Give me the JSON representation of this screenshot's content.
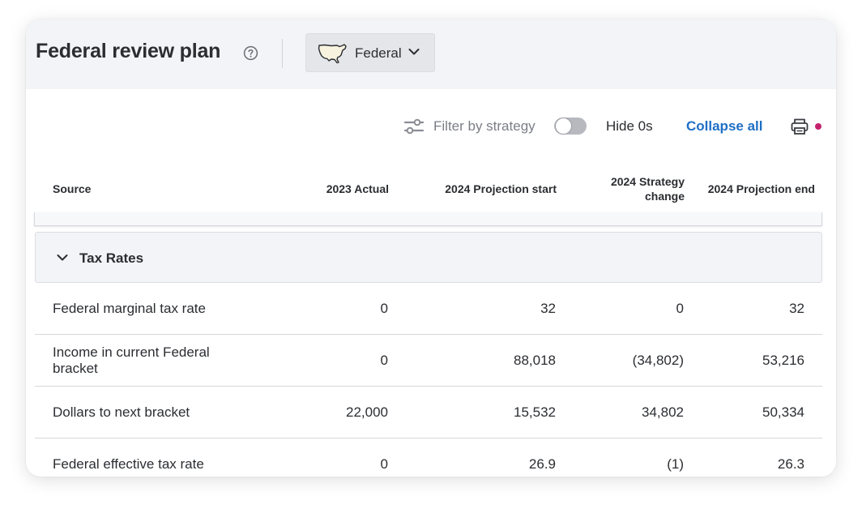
{
  "header": {
    "title": "Federal review plan",
    "jurisdiction": "Federal"
  },
  "toolbar": {
    "filter_label": "Filter by strategy",
    "hide_zeros_label": "Hide 0s",
    "hide_zeros_on": false,
    "collapse_label": "Collapse all"
  },
  "table": {
    "columns": [
      "Source",
      "2023 Actual",
      "2024 Projection start",
      "2024 Strategy change",
      "2024 Projection end"
    ],
    "group": {
      "label": "Tax Rates",
      "rows": [
        {
          "source": "Federal marginal tax rate",
          "actual_2023": "0",
          "projection_start_2024": "32",
          "strategy_change_2024": "0",
          "projection_end_2024": "32"
        },
        {
          "source": "Income in current Federal bracket",
          "actual_2023": "0",
          "projection_start_2024": "88,018",
          "strategy_change_2024": "(34,802)",
          "projection_end_2024": "53,216"
        },
        {
          "source": "Dollars to next bracket",
          "actual_2023": "22,000",
          "projection_start_2024": "15,532",
          "strategy_change_2024": "34,802",
          "projection_end_2024": "50,334"
        },
        {
          "source": "Federal effective tax rate",
          "actual_2023": "0",
          "projection_start_2024": "26.9",
          "strategy_change_2024": "(1)",
          "projection_end_2024": "26.3"
        }
      ]
    }
  },
  "colors": {
    "link": "#1f6fc5",
    "notification": "#c4226f",
    "header_bg": "#f3f4f7"
  },
  "icons": [
    "help-icon",
    "us-map-icon",
    "chevron-down-icon",
    "filter-sliders-icon",
    "printer-icon"
  ]
}
